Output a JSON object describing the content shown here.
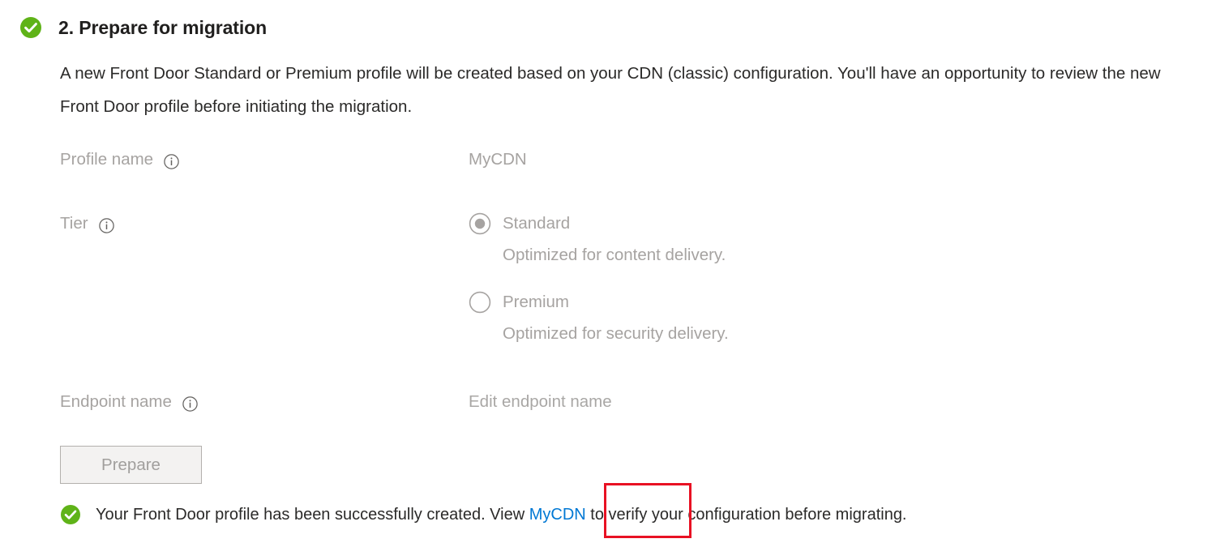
{
  "step": {
    "status_icon": "green-check-circle-icon",
    "title": "2. Prepare for migration",
    "description": "A new Front Door Standard or Premium profile will be created based on your CDN (classic) configuration. You'll have an opportunity to review the new Front Door profile before initiating the migration."
  },
  "form": {
    "profile_name": {
      "label": "Profile name",
      "info_icon": "info-circle-icon",
      "value": "MyCDN"
    },
    "tier": {
      "label": "Tier",
      "info_icon": "info-circle-icon",
      "options": [
        {
          "label": "Standard",
          "description": "Optimized for content delivery.",
          "selected": true
        },
        {
          "label": "Premium",
          "description": "Optimized for security delivery.",
          "selected": false
        }
      ]
    },
    "endpoint_name": {
      "label": "Endpoint name",
      "info_icon": "info-circle-icon",
      "value": "Edit endpoint name"
    }
  },
  "actions": {
    "prepare_label": "Prepare"
  },
  "status": {
    "icon": "green-check-circle-icon",
    "text_before": "Your Front Door profile has been successfully created. View",
    "link_label": "MyCDN",
    "text_after": "to verify your configuration before migrating."
  },
  "colors": {
    "success_green": "#5fb318",
    "link_blue": "#0078d4",
    "annotation_red": "#e81123",
    "disabled_text": "#a6a3a1",
    "body_text": "#2b2a29"
  }
}
